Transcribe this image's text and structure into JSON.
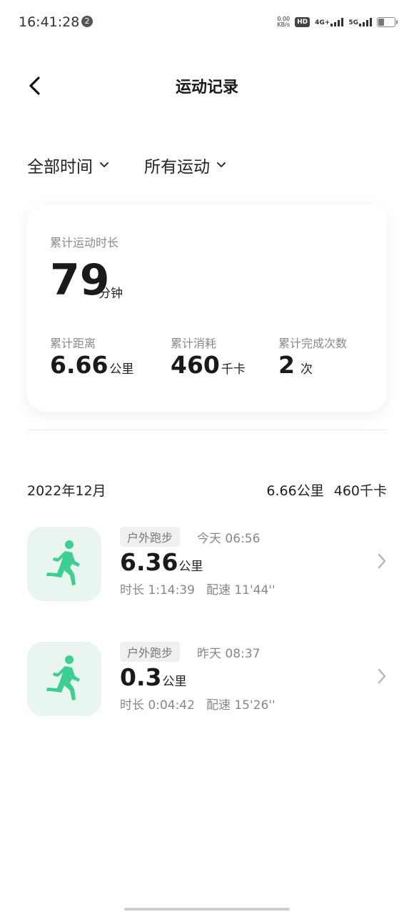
{
  "status_bar": {
    "time": "16:41:28",
    "notification_count": "2",
    "net_speed_value": "0.00",
    "net_speed_unit": "KB/s",
    "hd_label": "HD",
    "network_4g": "4G+",
    "network_5g": "5G"
  },
  "header": {
    "title": "运动记录",
    "back_icon": "chevron-left-icon"
  },
  "filters": {
    "time_range": "全部时间",
    "sport_type": "所有运动"
  },
  "summary": {
    "duration_label": "累计运动时长",
    "duration_value": "79",
    "duration_unit": "分钟",
    "distance_label": "累计距离",
    "distance_value": "6.66",
    "distance_unit": "公里",
    "calories_label": "累计消耗",
    "calories_value": "460",
    "calories_unit": "千卡",
    "count_label": "累计完成次数",
    "count_value": "2",
    "count_unit": "次"
  },
  "month": {
    "label": "2022年12月",
    "distance": "6.66公里",
    "calories": "460千卡"
  },
  "records": [
    {
      "type": "户外跑步",
      "when": "今天 06:56",
      "distance": "6.36",
      "unit": "公里",
      "duration": "时长 1:14:39",
      "pace": "配速 11'44''",
      "icon": "running-person-icon"
    },
    {
      "type": "户外跑步",
      "when": "昨天 08:37",
      "distance": "0.3",
      "unit": "公里",
      "duration": "时长 0:04:42",
      "pace": "配速 15'26''",
      "icon": "running-person-icon"
    }
  ],
  "colors": {
    "accent_green": "#3ccf91",
    "icon_bg": "#e9f6f0"
  }
}
